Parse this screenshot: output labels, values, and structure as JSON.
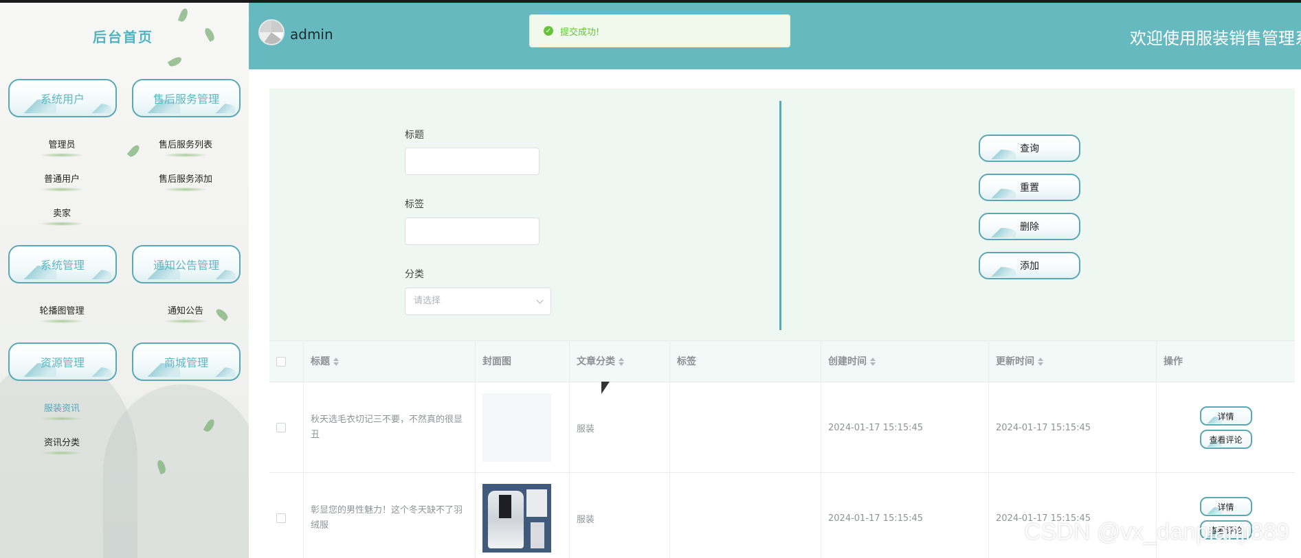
{
  "sidebar": {
    "title": "后台首页",
    "groups": [
      {
        "label": "系统用户",
        "items": [
          "管理员",
          "普通用户",
          "卖家"
        ]
      },
      {
        "label": "售后服务管理",
        "items": [
          "售后服务列表",
          "售后服务添加"
        ]
      },
      {
        "label": "系统管理",
        "items": [
          "轮播图管理"
        ]
      },
      {
        "label": "通知公告管理",
        "items": [
          "通知公告"
        ]
      },
      {
        "label": "资源管理",
        "items": [
          "服装资讯",
          "资讯分类"
        ]
      },
      {
        "label": "商城管理",
        "items": []
      }
    ]
  },
  "header": {
    "username": "admin",
    "welcome": "欢迎使用服装销售管理系"
  },
  "toast": {
    "message": "提交成功!"
  },
  "search": {
    "title_label": "标题",
    "tag_label": "标签",
    "category_label": "分类",
    "category_placeholder": "请选择",
    "buttons": {
      "query": "查询",
      "reset": "重置",
      "delete": "删除",
      "add": "添加"
    }
  },
  "table": {
    "columns": [
      "标题",
      "封面图",
      "文章分类",
      "标签",
      "创建时间",
      "更新时间",
      "操作"
    ],
    "rows": [
      {
        "title": "秋天选毛衣切记三不要，不然真的很显丑",
        "category": "服装",
        "tag": "",
        "created": "2024-01-17 15:15:45",
        "updated": "2024-01-17 15:15:45"
      },
      {
        "title": "彰显您的男性魅力！这个冬天缺不了羽绒服",
        "category": "服装",
        "tag": "",
        "created": "2024-01-17 15:15:45",
        "updated": "2024-01-17 15:15:45"
      }
    ],
    "ops": {
      "detail": "详情",
      "comments": "查看评论"
    }
  },
  "watermark": "CSDN @vx_danpianji889"
}
